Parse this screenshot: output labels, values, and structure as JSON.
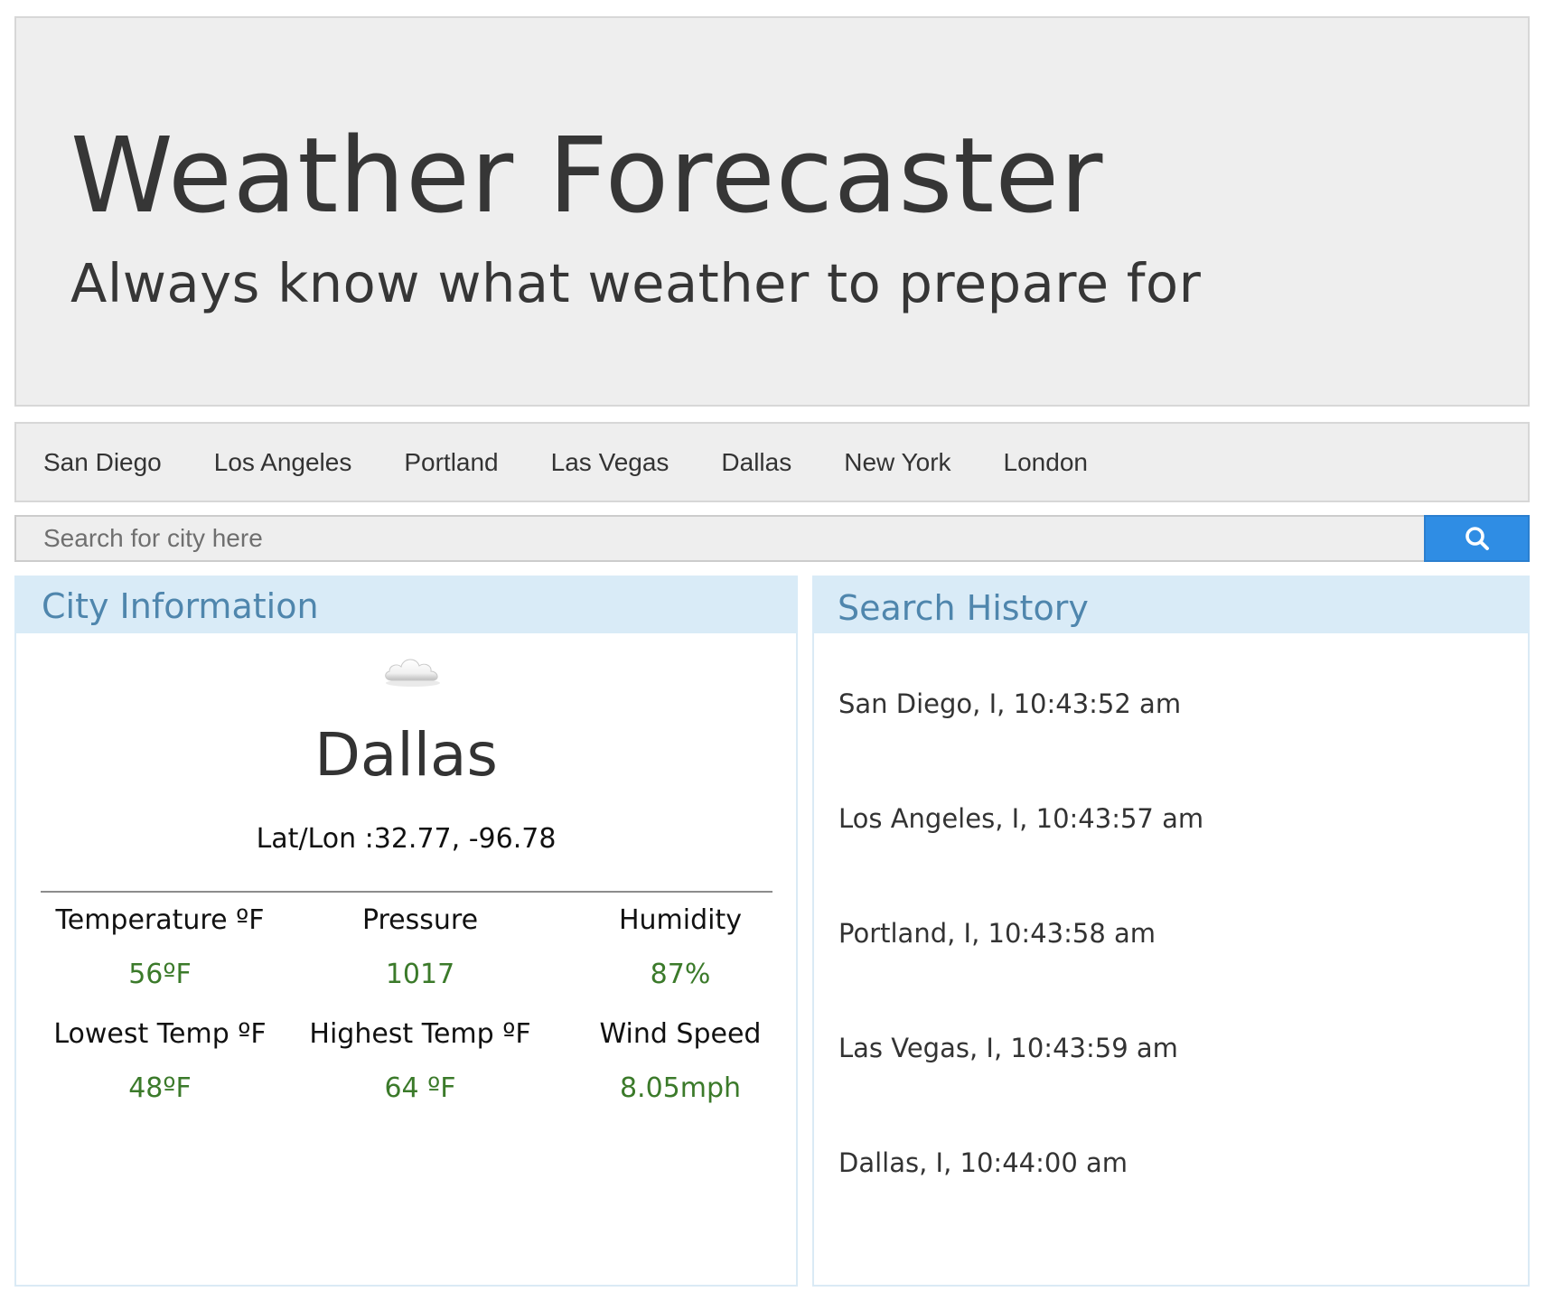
{
  "header": {
    "title": "Weather Forecaster",
    "subtitle": "Always know what weather to prepare for"
  },
  "nav": {
    "cities": [
      "San Diego",
      "Los Angeles",
      "Portland",
      "Las Vegas",
      "Dallas",
      "New York",
      "London"
    ]
  },
  "search": {
    "placeholder": "Search for city here",
    "value": "",
    "button_icon": "search-icon",
    "button_color": "#2f8de4"
  },
  "city_info": {
    "heading": "City Information",
    "weather_icon": "cloud-icon",
    "city": "Dallas",
    "latlon": "Lat/Lon :32.77, -96.78",
    "stats": {
      "temperature": {
        "label": "Temperature ºF",
        "value": "56ºF"
      },
      "pressure": {
        "label": "Pressure",
        "value": "1017"
      },
      "humidity": {
        "label": "Humidity",
        "value": "87%"
      },
      "lowest": {
        "label": "Lowest Temp ºF",
        "value": "48ºF"
      },
      "highest": {
        "label": "Highest Temp ºF",
        "value": "64 ºF"
      },
      "wind": {
        "label": "Wind Speed",
        "value": "8.05mph"
      }
    },
    "value_color": "#3b7a2a"
  },
  "history": {
    "heading": "Search History",
    "items": [
      "San Diego, I, 10:43:52 am",
      "Los Angeles, I, 10:43:57 am",
      "Portland, I, 10:43:58 am",
      "Las Vegas, I, 10:43:59 am",
      "Dallas, I, 10:44:00 am"
    ]
  }
}
